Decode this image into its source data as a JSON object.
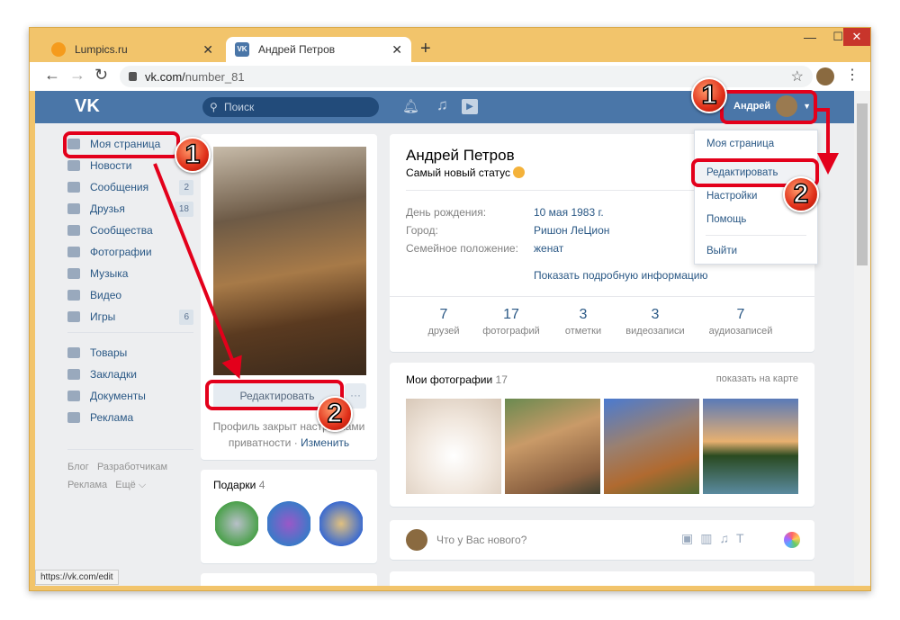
{
  "browser": {
    "tabs": [
      {
        "label": "Lumpics.ru",
        "icon": "lumpics-icon"
      },
      {
        "label": "Андрей Петров",
        "icon": "vk-icon",
        "active": true
      }
    ],
    "url_host": "vk.com/",
    "url_path": "number_81",
    "status_url": "https://vk.com/edit"
  },
  "header": {
    "logo": "VK",
    "search_placeholder": "Поиск",
    "user_name": "Андрей"
  },
  "sidebar": {
    "items": [
      {
        "label": "Моя страница",
        "icon": "home-icon"
      },
      {
        "label": "Новости",
        "icon": "news-icon"
      },
      {
        "label": "Сообщения",
        "icon": "messages-icon",
        "count": "2"
      },
      {
        "label": "Друзья",
        "icon": "friends-icon",
        "count": "18"
      },
      {
        "label": "Сообщества",
        "icon": "groups-icon"
      },
      {
        "label": "Фотографии",
        "icon": "camera-icon"
      },
      {
        "label": "Музыка",
        "icon": "music-icon"
      },
      {
        "label": "Видео",
        "icon": "video-icon"
      },
      {
        "label": "Игры",
        "icon": "games-icon",
        "count": "6"
      }
    ],
    "items2": [
      {
        "label": "Товары",
        "icon": "bag-icon"
      },
      {
        "label": "Закладки",
        "icon": "star-icon"
      },
      {
        "label": "Документы",
        "icon": "document-icon"
      },
      {
        "label": "Реклама",
        "icon": "megaphone-icon"
      }
    ],
    "footer": [
      "Блог",
      "Разработчикам",
      "Реклама",
      "Ещё"
    ]
  },
  "profile": {
    "name": "Андрей Петров",
    "status": "Самый новый статус",
    "edit_button": "Редактировать",
    "privacy_text": "Профиль закрыт настройками",
    "privacy_text2": "приватности",
    "privacy_link": "Изменить",
    "info": [
      {
        "label": "День рождения:",
        "value": "10 мая 1983 г."
      },
      {
        "label": "Город:",
        "value": "Ришон ЛеЦион"
      },
      {
        "label": "Семейное положение:",
        "value": "женат"
      }
    ],
    "more_link": "Показать подробную информацию",
    "counters": [
      {
        "n": "7",
        "t": "друзей"
      },
      {
        "n": "17",
        "t": "фотографий"
      },
      {
        "n": "3",
        "t": "отметки"
      },
      {
        "n": "3",
        "t": "видеозаписи"
      },
      {
        "n": "7",
        "t": "аудиозаписей"
      }
    ]
  },
  "gifts": {
    "title": "Подарки",
    "count": "4"
  },
  "photos": {
    "title": "Мои фотографии",
    "count": "17",
    "map_link": "показать на карте"
  },
  "post": {
    "placeholder": "Что у Вас нового?"
  },
  "dropdown": {
    "items": [
      "Моя страница",
      "Редактировать",
      "Настройки",
      "Помощь",
      "Выйти"
    ]
  },
  "annotations": {
    "step1": "1",
    "step2": "2",
    "color": "#e3001b"
  },
  "colors": {
    "vk_blue": "#4a76a8",
    "link": "#2a5885",
    "bg": "#edeef0",
    "frame": "#f2c46b"
  }
}
